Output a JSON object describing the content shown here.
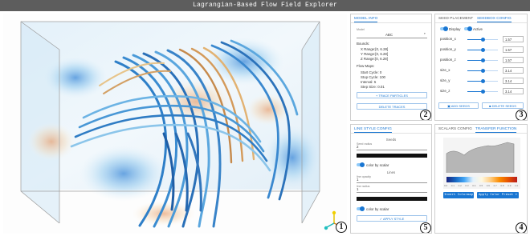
{
  "app": {
    "title": "Lagrangian-Based Flow Field Explorer"
  },
  "model_info": {
    "tab_label": "MODEL INFO",
    "select_label": "Model",
    "select_value": "ABC",
    "bounds_title": "Bounds:",
    "bounds": [
      "X Range:[0, 6.28]",
      "Y Range:[0, 6.28]",
      "Z Range:[0, 6.28]"
    ],
    "flow_maps_title": "Flow Maps:",
    "flow_maps": [
      "Start Cycle: 0",
      "Stop Cycle: 100",
      "Interval: 5",
      "Step Size: 0.01"
    ],
    "trace_button": "+ TRACE PARTICLES",
    "delete_button": "DELETE TRACES",
    "badge": "2"
  },
  "seed_placement": {
    "tabs": [
      "SEED PLACEMENT",
      "SEEDBOX CONFIG"
    ],
    "display_label": "Display",
    "active_label": "Active",
    "rows": [
      {
        "label": "position_x",
        "value": "1.57",
        "fraction": 0.5
      },
      {
        "label": "position_y",
        "value": "1.57",
        "fraction": 0.5
      },
      {
        "label": "position_z",
        "value": "1.57",
        "fraction": 0.5
      },
      {
        "label": "size_x",
        "value": "3.14",
        "fraction": 0.5
      },
      {
        "label": "size_y",
        "value": "3.14",
        "fraction": 0.5
      },
      {
        "label": "size_z",
        "value": "3.14",
        "fraction": 0.5
      }
    ],
    "add_button": "ADD SEEDS",
    "delete_button": "DELETE SEEDS",
    "badge": "3"
  },
  "line_style": {
    "tab_label": "LINE STYLE CONFIG",
    "seeds_title": "Seeds",
    "seed_radius_label": "Seed radius",
    "seed_radius_value": "2",
    "color_by_scalar": "color by scalar",
    "lines_title": "Lines",
    "line_opacity_label": "line opacity",
    "line_opacity_value": "1",
    "line_radius_label": "line radius",
    "line_radius_value": "1",
    "color_by_scalar_2": "color by scalar",
    "apply_button": "✓ APPLY STYLE",
    "badge": "5"
  },
  "scalars": {
    "tabs": [
      "SCALARS CONFIG",
      "TRANSFER FUNCTION"
    ],
    "colorbar_ticks": [
      "0.0",
      "0.1",
      "0.2",
      "0.3",
      "0.4",
      "0.5",
      "0.6",
      "0.7",
      "0.8",
      "0.9",
      "1.0"
    ],
    "invert_button": "Invert Colormap",
    "preset_button": "Apply Color Preset ▾",
    "badge": "4"
  },
  "viewport": {
    "badge": "1"
  },
  "colors": {
    "accent": "#1976d2",
    "titlebar": "#5d5d5d"
  }
}
